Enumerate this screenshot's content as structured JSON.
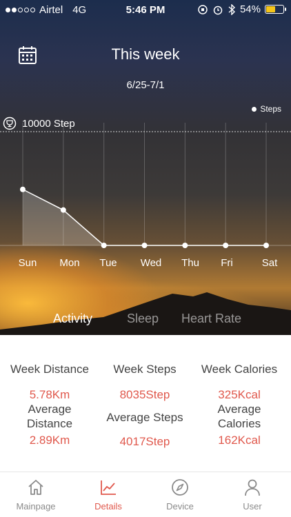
{
  "status_bar": {
    "carrier": "Airtel",
    "network": "4G",
    "time": "5:46 PM",
    "battery": "54%",
    "battery_level": 0.54
  },
  "header": {
    "title": "This week",
    "date_range": "6/25-7/1"
  },
  "chart_data": {
    "type": "area",
    "categories": [
      "Sun",
      "Mon",
      "Tue",
      "Wed",
      "Thu",
      "Fri",
      "Sat"
    ],
    "series": [
      {
        "name": "Steps",
        "values": [
          4925,
          3110,
          0,
          0,
          0,
          0,
          0
        ]
      }
    ],
    "goal_line": 10000,
    "goal_label": "10000 Step",
    "ylim": [
      0,
      10000
    ],
    "legend": "top-right"
  },
  "tabs": [
    {
      "label": "Activity",
      "active": true
    },
    {
      "label": "Sleep",
      "active": false
    },
    {
      "label": "Heart Rate",
      "active": false
    }
  ],
  "stats": {
    "distance": {
      "heading": "Week Distance",
      "value": "5.78Km",
      "avg_label_1": "Average",
      "avg_label_2": "Distance",
      "avg_value": "2.89Km"
    },
    "steps": {
      "heading": "Week Steps",
      "value": "8035Step",
      "avg_label": "Average Steps",
      "avg_value": "4017Step"
    },
    "calories": {
      "heading": "Week Calories",
      "value": "325Kcal",
      "avg_label_1": "Average",
      "avg_label_2": "Calories",
      "avg_value": "162Kcal"
    }
  },
  "nav": [
    {
      "label": "Mainpage",
      "icon": "home-icon",
      "active": false
    },
    {
      "label": "Details",
      "icon": "chart-icon",
      "active": true
    },
    {
      "label": "Device",
      "icon": "compass-icon",
      "active": false
    },
    {
      "label": "User",
      "icon": "user-icon",
      "active": false
    }
  ],
  "colors": {
    "accent": "#e0584c",
    "nav_inactive": "#8a8a8a"
  }
}
